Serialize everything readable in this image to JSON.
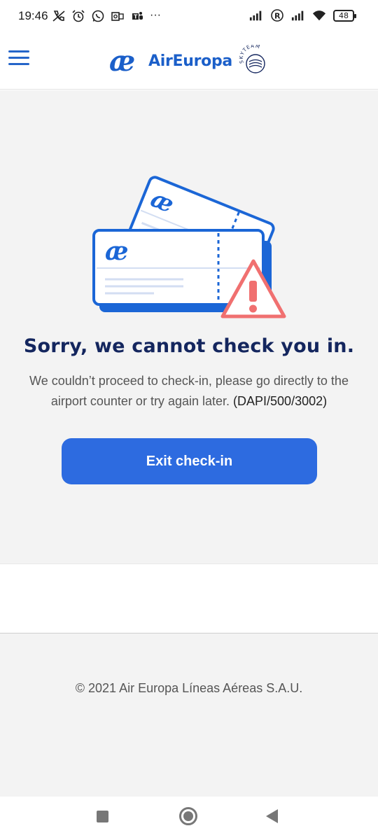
{
  "status_bar": {
    "time": "19:46",
    "battery": "48",
    "icons_left": [
      "muted-call-icon",
      "alarm-icon",
      "whatsapp-icon",
      "outlook-icon",
      "teams-icon",
      "more-dots-icon"
    ],
    "icons_right": [
      "signal-icon",
      "registered-icon",
      "signal-icon",
      "wifi-icon",
      "battery-icon"
    ],
    "more": "···"
  },
  "header": {
    "brand": "AirEuropa",
    "partner": "SKYTEAM",
    "menu_icon": "hamburger-menu-icon",
    "brand_color": "#1b5fc9"
  },
  "main": {
    "title": "Sorry, we cannot check you in.",
    "message": "We couldn’t proceed to check-in, please go directly to the airport counter or try again later.",
    "error_code": "(DAPI/500/3002)",
    "button_label": "Exit check-in",
    "button_color": "#2d6be0",
    "title_color": "#14265e",
    "warning_color": "#f07070"
  },
  "footer": {
    "copyright": "© 2021 Air Europa Líneas Aéreas S.A.U."
  },
  "nav_bar": {
    "icons": [
      "recents-square-icon",
      "home-circle-icon",
      "back-triangle-icon"
    ]
  }
}
